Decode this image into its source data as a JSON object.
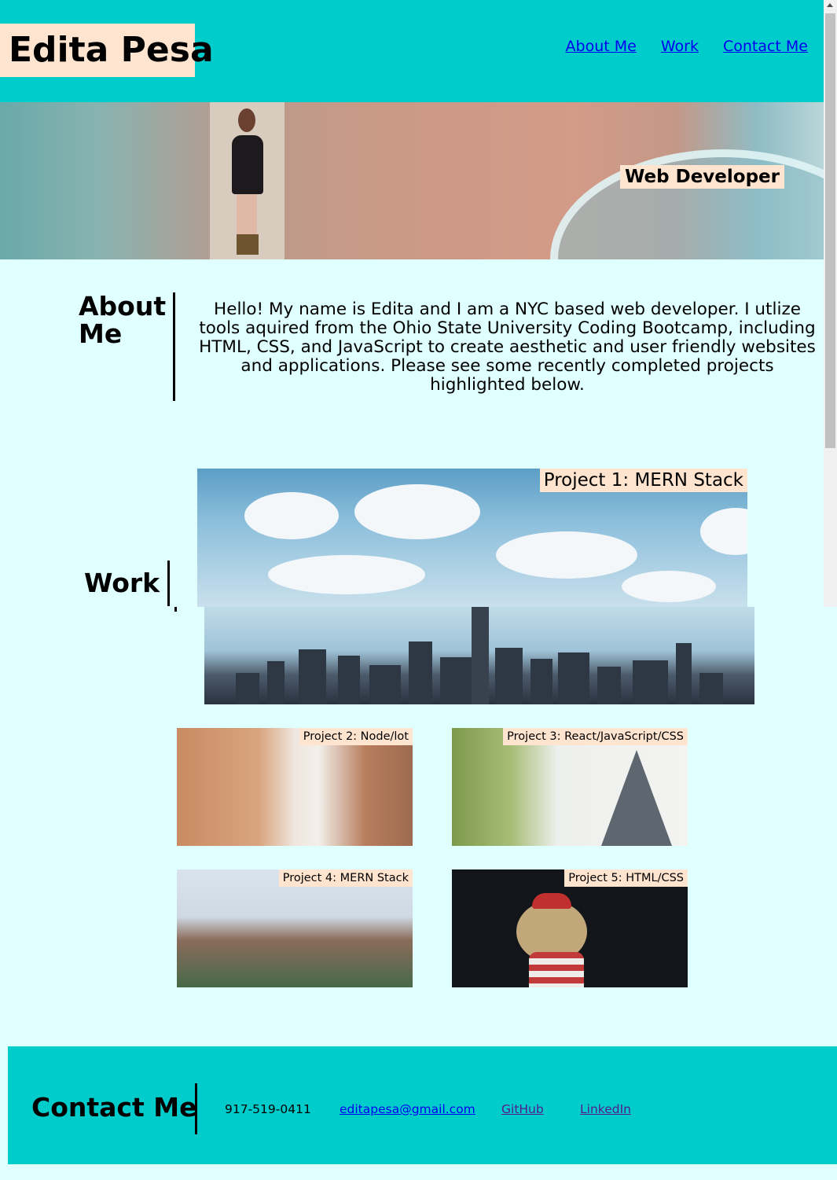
{
  "header": {
    "site_name": "Edita Pesa",
    "nav": [
      "About Me",
      "Work",
      "Contact Me"
    ]
  },
  "hero": {
    "role": "Web Developer"
  },
  "about": {
    "title": "About Me",
    "text": "Hello! My name is Edita and I am a NYC based web developer. I utlize tools aquired from the Ohio State University Coding Bootcamp, including HTML, CSS, and JavaScript to create aesthetic and user friendly websites and applications. Please see some recently completed projects highlighted below."
  },
  "work": {
    "title": "Work",
    "projects": [
      "Project 1: MERN Stack",
      "Project 2: Node/lot",
      "Project 3: React/JavaScript/CSS",
      "Project 4: MERN Stack",
      "Project 5: HTML/CSS"
    ]
  },
  "footer": {
    "title": "Contact Me",
    "phone": "917-519-0411",
    "email": "editapesa@gmail.com",
    "github": "GitHub",
    "linkedin": "LinkedIn"
  },
  "colors": {
    "header_bg": "#00cccc",
    "page_bg": "#e0ffff",
    "label_bg": "#ffe4cf"
  }
}
